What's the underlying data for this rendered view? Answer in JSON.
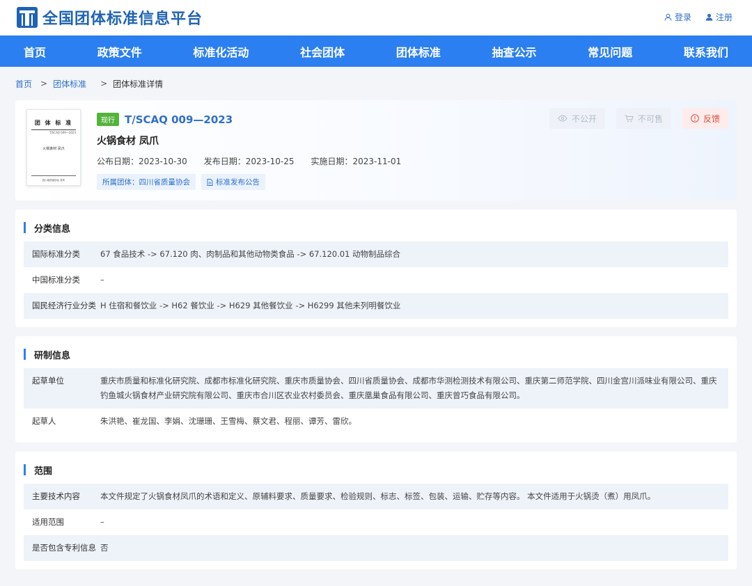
{
  "header": {
    "site_title": "全国团体标准信息平台",
    "login": "登录",
    "register": "注册"
  },
  "nav": [
    "首页",
    "政策文件",
    "标准化活动",
    "社会团体",
    "团体标准",
    "抽查公示",
    "常见问题",
    "联系我们"
  ],
  "breadcrumb": {
    "home": "首页",
    "sep1": ">",
    "group_std": "团体标准",
    "sep2": ">",
    "current": "团体标准详情"
  },
  "standard": {
    "status": "现行",
    "code": "T/SCAQ 009—2023",
    "name": "火锅食材 凤爪",
    "publish_date": "公布日期：2023-10-30",
    "release_date": "发布日期：2023-10-25",
    "impl_date": "实施日期：2023-11-01",
    "org_tag": "所属团体：四川省质量协会",
    "notice_tag": "标准发布公告",
    "thumb": {
      "title": "团 体 标 准",
      "code": "T/SCAQ 009—2023",
      "name": "火锅食材 凤爪",
      "footer": "四川省质量协会 发布"
    }
  },
  "actions": {
    "private": "不公开",
    "not_for_sale": "不可售",
    "feedback": "反馈"
  },
  "classification": {
    "title": "分类信息",
    "rows": [
      {
        "label": "国际标准分类",
        "value": "67 食品技术 -> 67.120 肉、肉制品和其他动物类食品 -> 67.120.01 动物制品综合"
      },
      {
        "label": "中国标准分类",
        "value": "–"
      },
      {
        "label": "国民经济行业分类",
        "value": "H 住宿和餐饮业 -> H62 餐饮业 -> H629 其他餐饮业 -> H6299 其他未列明餐饮业"
      }
    ]
  },
  "development": {
    "title": "研制信息",
    "rows": [
      {
        "label": "起草单位",
        "value": "重庆市质量和标准化研究院、成都市标准化研究院、重庆市质量协会、四川省质量协会、成都市华测检测技术有限公司、重庆第二师范学院、四川金宫川派味业有限公司、重庆钓鱼城火锅食材产业研究院有限公司、重庆市合川区农业农村委员会、重庆凰巢食品有限公司、重庆曾巧食品有限公司。"
      },
      {
        "label": "起草人",
        "value": "朱洪艳、崔龙国、李娟、沈珊珊、王雪梅、蔡文君、程丽、谭芳、雷欣。"
      }
    ]
  },
  "scope": {
    "title": "范围",
    "rows": [
      {
        "label": "主要技术内容",
        "value": "本文件规定了火锅食材凤爪的术语和定义、原辅料要求、质量要求、检验规则、标志、标签、包装、运输、贮存等内容。 本文件适用于火锅烫（煮）用凤爪。"
      },
      {
        "label": "适用范围",
        "value": "–"
      },
      {
        "label": "是否包含专利信息",
        "value": "否"
      }
    ]
  }
}
